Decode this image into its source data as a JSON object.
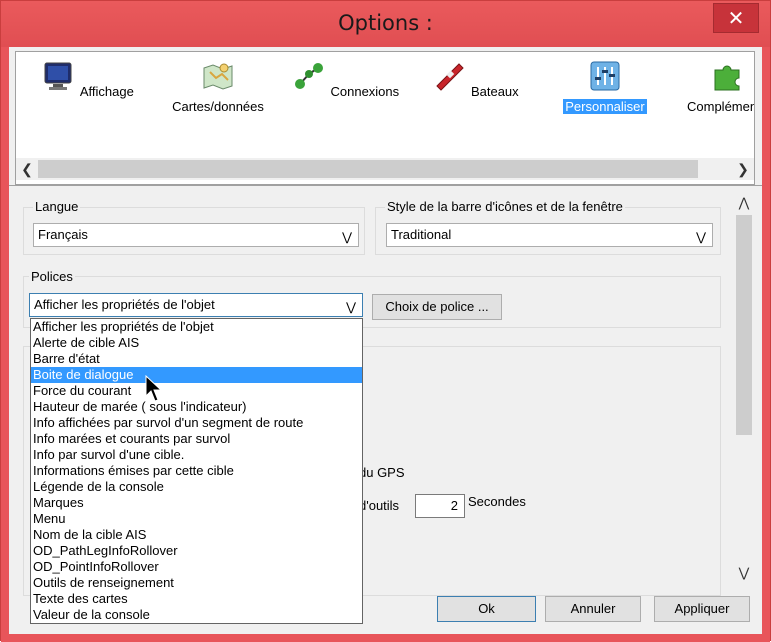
{
  "window": {
    "title": "Options :",
    "close_glyph": "✕"
  },
  "toolbar": {
    "items": [
      {
        "label": "Affichage",
        "icon": "monitor-icon"
      },
      {
        "label": "Cartes/données",
        "icon": "charts-icon"
      },
      {
        "label": "Connexions",
        "icon": "connections-icon"
      },
      {
        "label": "Bateaux",
        "icon": "boat-icon"
      },
      {
        "label": "Personnaliser",
        "icon": "sliders-icon",
        "selected": true
      },
      {
        "label": "Compléments",
        "icon": "puzzle-icon"
      }
    ]
  },
  "langue": {
    "label": "Langue",
    "value": "Français"
  },
  "style": {
    "label": "Style de la barre d'icônes et de la fenêtre",
    "value": "Traditional"
  },
  "polices": {
    "label": "Polices",
    "value": "Afficher les propriétés de l'objet",
    "choose_button": "Choix de police ...",
    "selected_index": 3,
    "options": [
      "Afficher les propriétés de l'objet",
      "Alerte de cible AIS",
      "Barre d'état",
      "Boite de dialogue",
      "Force du courant",
      "Hauteur de marée ( sous l'indicateur)",
      "Info affichées par survol d'un segment de route",
      "Info marées et courants par survol",
      "Info par survol d'une cible.",
      "Informations émises par cette cible",
      "Légende de la console",
      "Marques",
      "Menu",
      "Nom de la cible AIS",
      "OD_PathLegInfoRollover",
      "OD_PointInfoRollover",
      "Outils de renseignement",
      "Texte des cartes",
      "Valeur de la console"
    ]
  },
  "hidden": {
    "gps_text": "du GPS",
    "outils_text": "d'outils",
    "seconds_value": "2",
    "seconds_label": "Secondes"
  },
  "buttons": {
    "ok": "Ok",
    "cancel": "Annuler",
    "apply": "Appliquer"
  },
  "colors": {
    "titlebar": "#e8555a",
    "selection": "#3399ff",
    "close": "#c7333a"
  }
}
